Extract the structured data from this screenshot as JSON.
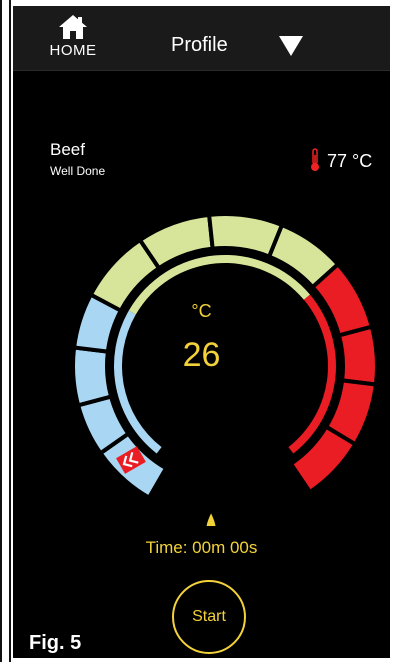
{
  "header": {
    "home_label": "HOME",
    "profile_label": "Profile"
  },
  "food": {
    "name": "Beef",
    "doneness": "Well Done"
  },
  "ambient": {
    "value": "77 °C"
  },
  "gauge": {
    "unit": "°C",
    "temperature": "26"
  },
  "timer": {
    "text": "Time: 00m 00s"
  },
  "controls": {
    "start_label": "Start"
  },
  "figure": {
    "label": "Fig. 5"
  },
  "colors": {
    "cold": "#a9d6f2",
    "target": "#d7e59a",
    "hot": "#ea1c24",
    "accent": "#f2d23a",
    "background": "#000000"
  },
  "icons": {
    "home": "home-icon",
    "dropdown": "triangle-down-icon",
    "ambient": "thermometer-icon",
    "pointer": "double-chevron-icon"
  }
}
